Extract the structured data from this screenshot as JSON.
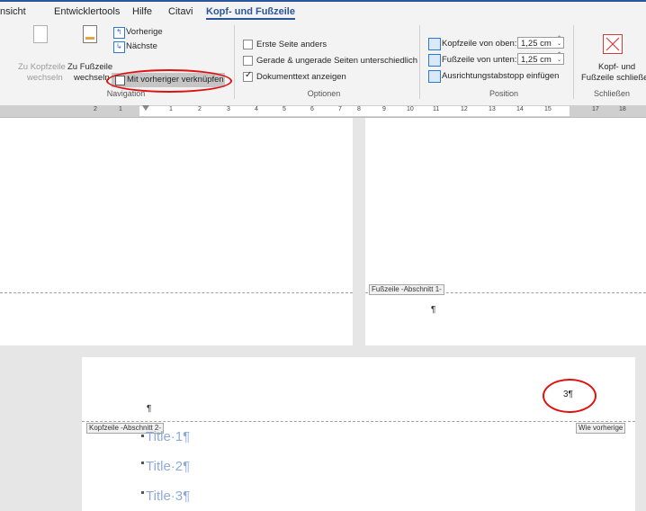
{
  "tabs": [
    "nsicht",
    "Entwicklertools",
    "Hilfe",
    "Citavi",
    "Kopf- und Fußzeile"
  ],
  "navigation": {
    "group_label": "Navigation",
    "to_header": [
      "Zu Kopfzeile",
      "wechseln"
    ],
    "to_footer": [
      "Zu Fußzeile",
      "wechseln"
    ],
    "previous": "Vorherige",
    "next": "Nächste",
    "link_previous": "Mit vorheriger verknüpfen"
  },
  "options": {
    "group_label": "Optionen",
    "first_page": "Erste Seite anders",
    "odd_even": "Gerade & ungerade Seiten unterschiedlich",
    "show_text": "Dokumenttext anzeigen"
  },
  "position": {
    "group_label": "Position",
    "header_from_top": "Kopfzeile von oben:",
    "header_value": "1,25 cm",
    "footer_from_bottom": "Fußzeile von unten:",
    "footer_value": "1,25 cm",
    "align_tab": "Ausrichtungstabstopp einfügen"
  },
  "close": {
    "group_label": "Schließen",
    "label": [
      "Kopf- und",
      "Fußzeile schließen"
    ]
  },
  "ruler": {
    "left": [
      "2",
      "1"
    ],
    "marks": [
      "1",
      "2",
      "3",
      "4",
      "5",
      "6",
      "7",
      "8",
      "9",
      "10",
      "11",
      "12",
      "13",
      "14",
      "15"
    ],
    "right": [
      "17",
      "18"
    ]
  },
  "doc": {
    "footer_tag_1": "Fußzeile -Abschnitt 1-",
    "pilcrow": "¶",
    "header_tag_2": "Kopfzeile -Abschnitt 2-",
    "same_as_previous": "Wie vorherige",
    "page_num": "3¶",
    "titles": [
      "Title·1¶",
      "Title·2¶",
      "Title·3¶"
    ]
  }
}
